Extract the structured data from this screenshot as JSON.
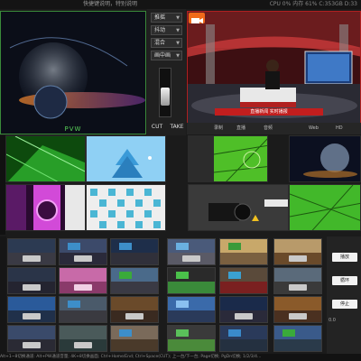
{
  "topbar": {
    "left_text": "快捷键说明，特别说明",
    "right_text": "CPU 0% 内存 61%    C:353GB D:33"
  },
  "preview": {
    "label": "PVW"
  },
  "controls": {
    "menus": [
      {
        "label": "推摇"
      },
      {
        "label": "抖动"
      },
      {
        "label": "混合"
      },
      {
        "label": "画中画"
      }
    ],
    "cut_label": "CUT",
    "take_label": "TAKE",
    "tbar_level": 0.35
  },
  "program": {
    "ticker_text": "直播新闻 实时播报",
    "bar": {
      "rec": "录制",
      "stream": "直播",
      "audio": "音频",
      "mode": "Web",
      "hd": "HD"
    }
  },
  "library": {
    "side_labels": [
      "播放",
      "循环",
      "停止"
    ],
    "value_label": "0.0"
  },
  "statusbar": {
    "text": "Alt+1~8切换通道: Alt+PW通道音量; 4K+8切换画面; Ctrl+Home/End; Ctrl+Space(CUT); 上一台/下一台; Page切换; PgDn切换; 1/2/3/4..."
  },
  "colors": {
    "preview_border": "#3a8a3a",
    "program_border": "#b02020",
    "accent": "#f06a1a"
  }
}
